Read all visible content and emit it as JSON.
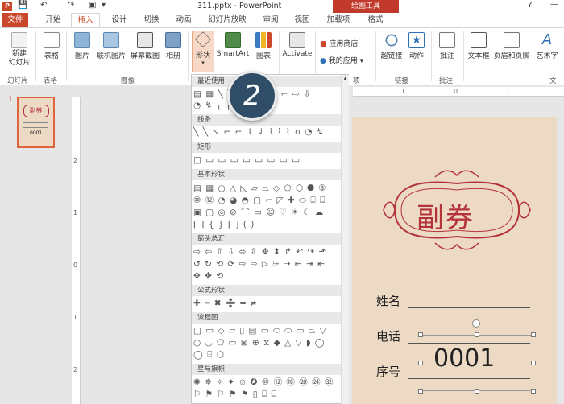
{
  "titlebar": {
    "app_icon": "P",
    "quick_access": [
      "save-icon",
      "undo-icon",
      "redo-icon",
      "start-icon"
    ],
    "document_title": "311.pptx - PowerPoint",
    "tool_context_title": "绘图工具",
    "help": "?",
    "minimize": "—"
  },
  "tabs": [
    {
      "label": "文件"
    },
    {
      "label": "开始"
    },
    {
      "label": "插入"
    },
    {
      "label": "设计"
    },
    {
      "label": "切换"
    },
    {
      "label": "动画"
    },
    {
      "label": "幻灯片放映"
    },
    {
      "label": "审阅"
    },
    {
      "label": "视图"
    },
    {
      "label": "加载项"
    },
    {
      "label": "格式"
    }
  ],
  "ribbon": {
    "new_slide": "新建\n幻灯片",
    "table": "表格",
    "picture": "图片",
    "online_picture": "联机图片",
    "screenshot": "屏幕截图",
    "album": "相册",
    "shapes": "形状",
    "smartart": "SmartArt",
    "chart": "图表",
    "activate": "Activate",
    "app_store": "应用商店",
    "my_apps": "我的应用",
    "hyperlink": "超链接",
    "action": "动作",
    "comment": "批注",
    "textbox": "文本框",
    "header_footer": "页眉和页脚",
    "wordart": "艺术字",
    "groups": {
      "slides": "幻灯片",
      "tables": "表格",
      "images": "图像",
      "apps": "项",
      "links": "链接",
      "comments": "批注",
      "text": "文"
    }
  },
  "slide_panel": {
    "slide_number": "1"
  },
  "thumbnail": {
    "title": "副券",
    "number": "0001"
  },
  "shapes_menu": {
    "sections": [
      {
        "header": "最近使用",
        "rows": [
          "▤ ▦ ╲ ╲ □ ○ △ ╲ ⌐ ⇨ ⇩",
          "◔ ↯ ╮ ╭"
        ]
      },
      {
        "header": "线条",
        "rows": [
          "╲ ╲ ↖ ⌐ ⌐ ⇂ ⇃ ⌇ ⌇ ⌇ ∩ ◔ ↯"
        ]
      },
      {
        "header": "矩形",
        "rows": [
          "□ ▭ ▭ ▭ ▭ ▭ ▭ ▭ ▭"
        ]
      },
      {
        "header": "基本形状",
        "rows": [
          "▤ ▦ ○ △ ◺ ▱ ⏢ ◇ ⬠ ⬡ ⯃ ⑧",
          "⑩ ⑫ ◔ ◕ ◓ ▢ ⌐ ◸ ✚ ⬭ ⌸ ⌸",
          "▣ ▢ ◎ ⊘ ⌒ ▭ ☺ ♡ ☀ ☾ ☁",
          "⌈ ⌉ { } [ ] ( )"
        ]
      },
      {
        "header": "箭头总汇",
        "rows": [
          "⇨ ⇦ ⇧ ⇩ ⬄ ⇳ ✥ ⬍ ↱ ↶ ↷ ⬏",
          "↺ ↻ ⟲ ⟳ ⇨ ⇨ ▷ ⌲ ⇢ ⇤ ⇥ ⇤",
          "✥ ✥ ⟲"
        ]
      },
      {
        "header": "公式形状",
        "rows": [
          "✚ ━ ✖ ➗ ═ ≠"
        ]
      },
      {
        "header": "流程图",
        "rows": [
          "□ ▭ ◇ ▱ ▯ ▤ ▭ ⬭ ⬭ ▭ ⏢ ▽",
          "○ ◡ ⬠ ▭ ⊠ ⊕ ⧖ ◆ △ ▽ ◗ ◯",
          "◯ ⌸ ⬡"
        ]
      },
      {
        "header": "星与旗帜",
        "rows": [
          "✺ ✵ ✧ ✦ ✩ ✪ ⑩ ⑫ ⑯ ⑳ ㉔ ㉜",
          "⚐ ⚑ ⚐ ⚑ ⚑ ▯ ⌸ ⌸"
        ]
      }
    ]
  },
  "step_badge": "2",
  "ruler": {
    "h_marks": [
      "1",
      "0",
      "1"
    ],
    "v_marks": [
      "2",
      "1",
      "0",
      "1",
      "2"
    ]
  },
  "ticket": {
    "title": "副券",
    "fields": [
      {
        "label": "姓名"
      },
      {
        "label": "电话"
      },
      {
        "label": "序号"
      }
    ],
    "number": "0001"
  },
  "colors": {
    "accent": "#c9482b",
    "ticket_red": "#b4333a",
    "ticket_bg": "#eddac4",
    "badge": "#2f4d66"
  }
}
